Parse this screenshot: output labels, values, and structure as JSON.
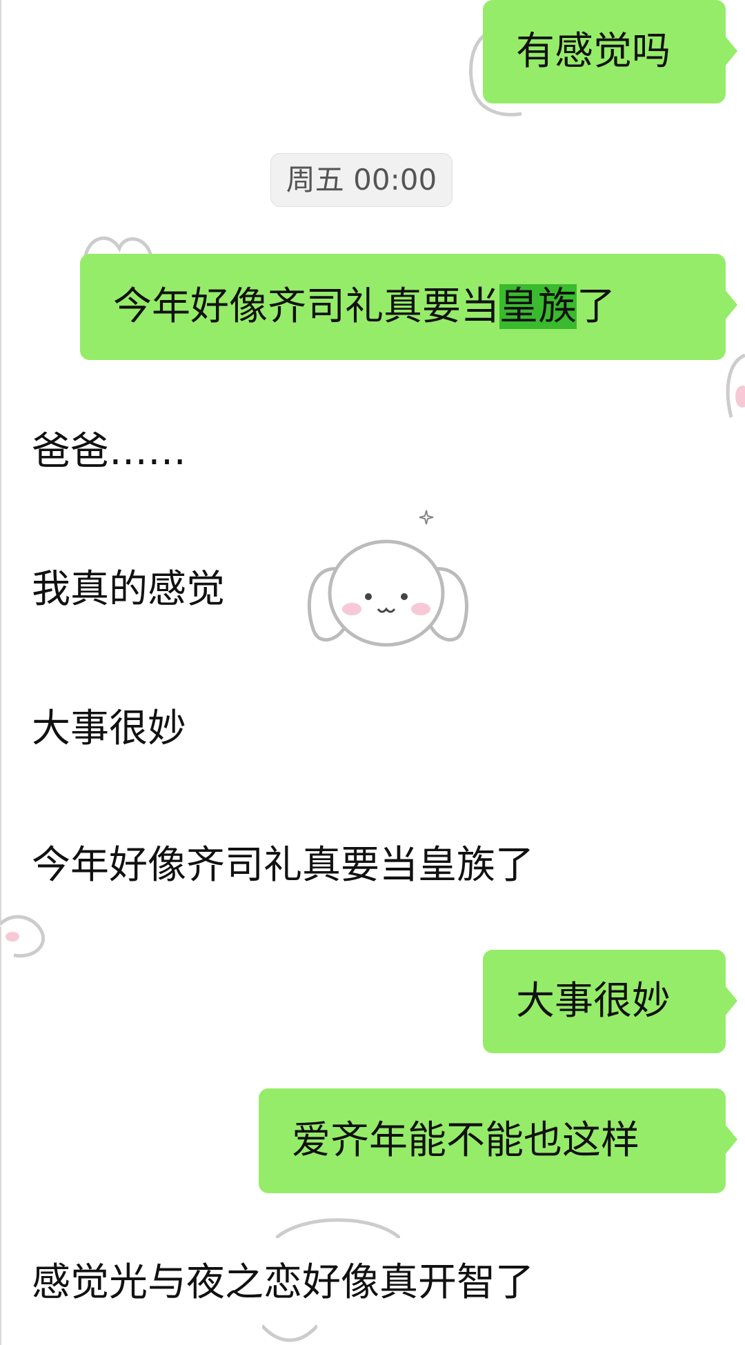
{
  "chat": {
    "timestamp": "周五 00:00",
    "messages": [
      {
        "id": "m1",
        "side": "sent",
        "text": "有感觉吗"
      },
      {
        "id": "m2",
        "side": "sent",
        "text_before": "今年好像齐司礼真要当",
        "text_highlight": "皇族",
        "text_after": "了"
      },
      {
        "id": "m3",
        "side": "received",
        "text": "爸爸……"
      },
      {
        "id": "m4",
        "side": "received",
        "text": "我真的感觉"
      },
      {
        "id": "m5",
        "side": "received",
        "text": "大事很妙"
      },
      {
        "id": "m6",
        "side": "received",
        "text": "今年好像齐司礼真要当皇族了"
      },
      {
        "id": "m7",
        "side": "sent",
        "text": "大事很妙"
      },
      {
        "id": "m8",
        "side": "sent",
        "text": "爱齐年能不能也这样"
      },
      {
        "id": "m9",
        "side": "received",
        "text": "感觉光与夜之恋好像真开智了"
      }
    ]
  },
  "colors": {
    "sent_bubble": "#95ec69",
    "highlight": "#3aba2e",
    "background": "#ffffff",
    "timestamp_bg": "#f1f1f1"
  },
  "decorations": [
    "bunny-sticker",
    "sparkle-icon"
  ]
}
